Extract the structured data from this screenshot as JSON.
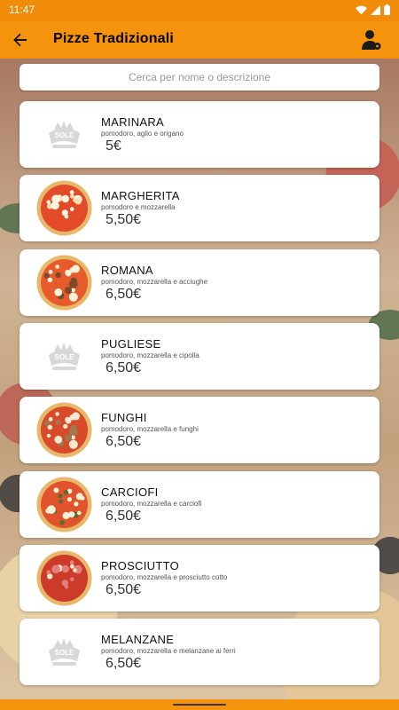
{
  "status_bar": {
    "time": "11:47"
  },
  "app_bar": {
    "title": "Pizze Tradizionali"
  },
  "search": {
    "placeholder": "Cerca per nome o descrizione"
  },
  "items": [
    {
      "name": "MARINARA",
      "description": "pomodoro, aglio e origano",
      "price": "5€",
      "image": "logo-placeholder"
    },
    {
      "name": "MARGHERITA",
      "description": "pomodoro e mozzarella",
      "price": "5,50€",
      "image": "pizza-margherita"
    },
    {
      "name": "ROMANA",
      "description": "pomodoro, mozzarella e acciughe",
      "price": "6,50€",
      "image": "pizza-romana"
    },
    {
      "name": "PUGLIESE",
      "description": "pomodoro, mozzarella e cipolla",
      "price": "6,50€",
      "image": "logo-placeholder"
    },
    {
      "name": "FUNGHI",
      "description": "pomodoro, mozzarella e funghi",
      "price": "6,50€",
      "image": "pizza-funghi"
    },
    {
      "name": "CARCIOFI",
      "description": "pomodoro, mozzarella e carciofi",
      "price": "6,50€",
      "image": "pizza-carciofi"
    },
    {
      "name": "PROSCIUTTO",
      "description": "pomodoro, mozzarella e prosciutto cotto",
      "price": "6,50€",
      "image": "pizza-prosciutto"
    },
    {
      "name": "MELANZANE",
      "description": "pomodoro, mozzarella e melanzane ai ferri",
      "price": "6,50€",
      "image": "logo-placeholder"
    }
  ],
  "colors": {
    "accent": "#f5930d",
    "status": "#f08c0a",
    "card": "#ffffff"
  },
  "icons": {
    "back": "arrow-left-icon",
    "account": "account-settings-icon",
    "wifi": "wifi-icon",
    "signal": "signal-icon",
    "battery": "battery-icon"
  }
}
